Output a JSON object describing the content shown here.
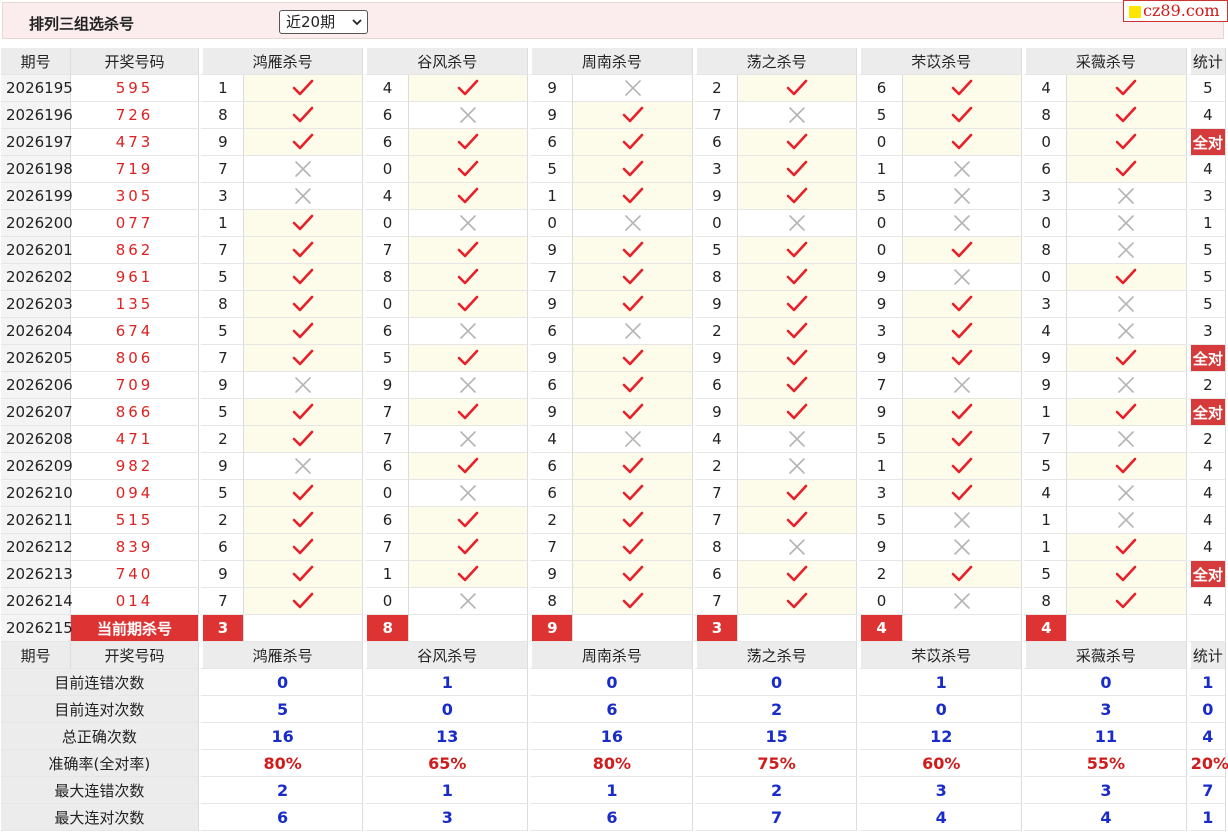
{
  "header": {
    "title": "排列三组选杀号",
    "period_select": "近20期",
    "site_badge": "cz89.com"
  },
  "columns": {
    "issue": "期号",
    "draw": "开奖号码",
    "experts": [
      "鸿雁杀号",
      "谷风杀号",
      "周南杀号",
      "荡之杀号",
      "芣苡杀号",
      "采薇杀号"
    ],
    "stat": "统计"
  },
  "rows": [
    {
      "issue": "2026195",
      "draw": "595",
      "picks": [
        [
          "1",
          true
        ],
        [
          "4",
          true
        ],
        [
          "9",
          false
        ],
        [
          "2",
          true
        ],
        [
          "6",
          true
        ],
        [
          "4",
          true
        ]
      ],
      "stat": "5"
    },
    {
      "issue": "2026196",
      "draw": "726",
      "picks": [
        [
          "8",
          true
        ],
        [
          "6",
          false
        ],
        [
          "9",
          true
        ],
        [
          "7",
          false
        ],
        [
          "5",
          true
        ],
        [
          "8",
          true
        ]
      ],
      "stat": "4"
    },
    {
      "issue": "2026197",
      "draw": "473",
      "picks": [
        [
          "9",
          true
        ],
        [
          "6",
          true
        ],
        [
          "6",
          true
        ],
        [
          "6",
          true
        ],
        [
          "0",
          true
        ],
        [
          "0",
          true
        ]
      ],
      "stat": "全对"
    },
    {
      "issue": "2026198",
      "draw": "719",
      "picks": [
        [
          "7",
          false
        ],
        [
          "0",
          true
        ],
        [
          "5",
          true
        ],
        [
          "3",
          true
        ],
        [
          "1",
          false
        ],
        [
          "6",
          true
        ]
      ],
      "stat": "4"
    },
    {
      "issue": "2026199",
      "draw": "305",
      "picks": [
        [
          "3",
          false
        ],
        [
          "4",
          true
        ],
        [
          "1",
          true
        ],
        [
          "9",
          true
        ],
        [
          "5",
          false
        ],
        [
          "3",
          false
        ]
      ],
      "stat": "3"
    },
    {
      "issue": "2026200",
      "draw": "077",
      "picks": [
        [
          "1",
          true
        ],
        [
          "0",
          false
        ],
        [
          "0",
          false
        ],
        [
          "0",
          false
        ],
        [
          "0",
          false
        ],
        [
          "0",
          false
        ]
      ],
      "stat": "1"
    },
    {
      "issue": "2026201",
      "draw": "862",
      "picks": [
        [
          "7",
          true
        ],
        [
          "7",
          true
        ],
        [
          "9",
          true
        ],
        [
          "5",
          true
        ],
        [
          "0",
          true
        ],
        [
          "8",
          false
        ]
      ],
      "stat": "5"
    },
    {
      "issue": "2026202",
      "draw": "961",
      "picks": [
        [
          "5",
          true
        ],
        [
          "8",
          true
        ],
        [
          "7",
          true
        ],
        [
          "8",
          true
        ],
        [
          "9",
          false
        ],
        [
          "0",
          true
        ]
      ],
      "stat": "5"
    },
    {
      "issue": "2026203",
      "draw": "135",
      "picks": [
        [
          "8",
          true
        ],
        [
          "0",
          true
        ],
        [
          "9",
          true
        ],
        [
          "9",
          true
        ],
        [
          "9",
          true
        ],
        [
          "3",
          false
        ]
      ],
      "stat": "5"
    },
    {
      "issue": "2026204",
      "draw": "674",
      "picks": [
        [
          "5",
          true
        ],
        [
          "6",
          false
        ],
        [
          "6",
          false
        ],
        [
          "2",
          true
        ],
        [
          "3",
          true
        ],
        [
          "4",
          false
        ]
      ],
      "stat": "3"
    },
    {
      "issue": "2026205",
      "draw": "806",
      "picks": [
        [
          "7",
          true
        ],
        [
          "5",
          true
        ],
        [
          "9",
          true
        ],
        [
          "9",
          true
        ],
        [
          "9",
          true
        ],
        [
          "9",
          true
        ]
      ],
      "stat": "全对"
    },
    {
      "issue": "2026206",
      "draw": "709",
      "picks": [
        [
          "9",
          false
        ],
        [
          "9",
          false
        ],
        [
          "6",
          true
        ],
        [
          "6",
          true
        ],
        [
          "7",
          false
        ],
        [
          "9",
          false
        ]
      ],
      "stat": "2"
    },
    {
      "issue": "2026207",
      "draw": "866",
      "picks": [
        [
          "5",
          true
        ],
        [
          "7",
          true
        ],
        [
          "9",
          true
        ],
        [
          "9",
          true
        ],
        [
          "9",
          true
        ],
        [
          "1",
          true
        ]
      ],
      "stat": "全对"
    },
    {
      "issue": "2026208",
      "draw": "471",
      "picks": [
        [
          "2",
          true
        ],
        [
          "7",
          false
        ],
        [
          "4",
          false
        ],
        [
          "4",
          false
        ],
        [
          "5",
          true
        ],
        [
          "7",
          false
        ]
      ],
      "stat": "2"
    },
    {
      "issue": "2026209",
      "draw": "982",
      "picks": [
        [
          "9",
          false
        ],
        [
          "6",
          true
        ],
        [
          "6",
          true
        ],
        [
          "2",
          false
        ],
        [
          "1",
          true
        ],
        [
          "5",
          true
        ]
      ],
      "stat": "4"
    },
    {
      "issue": "2026210",
      "draw": "094",
      "picks": [
        [
          "5",
          true
        ],
        [
          "0",
          false
        ],
        [
          "6",
          true
        ],
        [
          "7",
          true
        ],
        [
          "3",
          true
        ],
        [
          "4",
          false
        ]
      ],
      "stat": "4"
    },
    {
      "issue": "2026211",
      "draw": "515",
      "picks": [
        [
          "2",
          true
        ],
        [
          "6",
          true
        ],
        [
          "2",
          true
        ],
        [
          "7",
          true
        ],
        [
          "5",
          false
        ],
        [
          "1",
          false
        ]
      ],
      "stat": "4"
    },
    {
      "issue": "2026212",
      "draw": "839",
      "picks": [
        [
          "6",
          true
        ],
        [
          "7",
          true
        ],
        [
          "7",
          true
        ],
        [
          "8",
          false
        ],
        [
          "9",
          false
        ],
        [
          "1",
          true
        ]
      ],
      "stat": "4"
    },
    {
      "issue": "2026213",
      "draw": "740",
      "picks": [
        [
          "9",
          true
        ],
        [
          "1",
          true
        ],
        [
          "9",
          true
        ],
        [
          "6",
          true
        ],
        [
          "2",
          true
        ],
        [
          "5",
          true
        ]
      ],
      "stat": "全对"
    },
    {
      "issue": "2026214",
      "draw": "014",
      "picks": [
        [
          "7",
          true
        ],
        [
          "0",
          false
        ],
        [
          "8",
          true
        ],
        [
          "7",
          true
        ],
        [
          "0",
          false
        ],
        [
          "8",
          true
        ]
      ],
      "stat": "4"
    }
  ],
  "current": {
    "issue": "2026215",
    "label": "当前期杀号",
    "picks": [
      "3",
      "8",
      "9",
      "3",
      "4",
      "4"
    ]
  },
  "summary": [
    {
      "label": "目前连错次数",
      "values": [
        "0",
        "1",
        "0",
        "0",
        "1",
        "0"
      ],
      "stat": "1"
    },
    {
      "label": "目前连对次数",
      "values": [
        "5",
        "0",
        "6",
        "2",
        "0",
        "3"
      ],
      "stat": "0"
    },
    {
      "label": "总正确次数",
      "values": [
        "16",
        "13",
        "16",
        "15",
        "12",
        "11"
      ],
      "stat": "4"
    },
    {
      "label": "准确率(全对率)",
      "values": [
        "80%",
        "65%",
        "80%",
        "75%",
        "60%",
        "55%"
      ],
      "stat": "20%",
      "red": true
    },
    {
      "label": "最大连错次数",
      "values": [
        "2",
        "1",
        "1",
        "2",
        "3",
        "3"
      ],
      "stat": "7"
    },
    {
      "label": "最大连对次数",
      "values": [
        "6",
        "3",
        "6",
        "7",
        "4",
        "4"
      ],
      "stat": "1"
    }
  ],
  "colors": {
    "accent_red": "#d33333",
    "check_red": "#e8202a",
    "cross_gray": "#b5b5b5",
    "hit_cell_bg": "#fdfbe9",
    "summary_blue": "#1a2cc8"
  },
  "icons": {
    "hit": "check-icon",
    "miss": "cross-icon",
    "dropdown": "chevron-down-icon"
  }
}
